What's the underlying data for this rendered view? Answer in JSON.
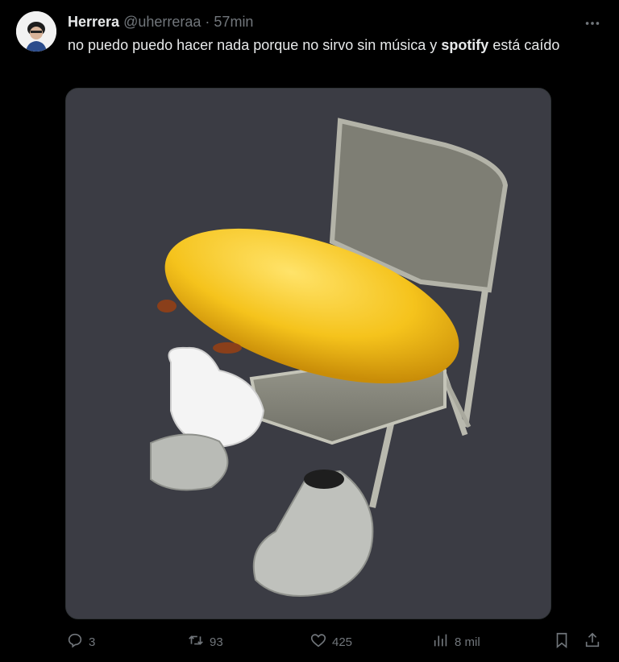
{
  "post": {
    "author_name": "Herrera",
    "author_handle": "@uherreraa",
    "separator": "·",
    "time": "57min",
    "text_before": "no puedo puedo hacer nada porque no sirvo sin música y ",
    "text_bold": "spotify",
    "text_after": " está caído"
  },
  "actions": {
    "replies": "3",
    "reposts": "93",
    "likes": "425",
    "views": "8 mil"
  },
  "icons": {
    "more": "more-dots-icon",
    "reply": "reply-icon",
    "repost": "repost-icon",
    "like": "heart-icon",
    "views": "views-chart-icon",
    "bookmark": "bookmark-icon",
    "share": "share-icon"
  },
  "colors": {
    "background": "#000000",
    "text": "#e7e9ea",
    "muted": "#71767b",
    "media_bg": "#3b3c44"
  }
}
